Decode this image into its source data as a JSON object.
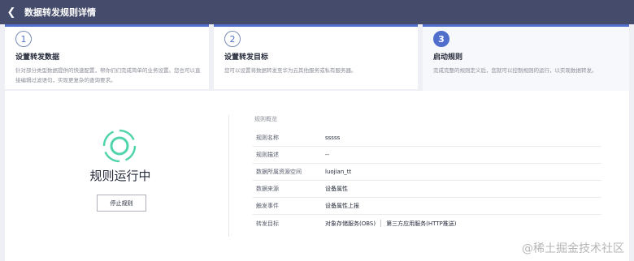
{
  "header": {
    "title": "数据转发规则详情",
    "back_icon": "chevron-left-icon"
  },
  "steps": [
    {
      "num": "1",
      "title": "设置转发数据",
      "desc": "针对部分类型数据提供的快速配置，帮你们们完成简单的业务设置。您也可以直接编辑过滤语句，实现更复杂的查询要求。"
    },
    {
      "num": "2",
      "title": "设置转发目标",
      "desc": "您可以设置将数据转发至华为云其他服务或私有服务器。"
    },
    {
      "num": "3",
      "title": "启动规则",
      "desc": "完成完整的规则定义后，您就可以控制规则的运行，以实现数据转发。"
    }
  ],
  "status": {
    "text": "规则运行中",
    "stop_label": "停止规则",
    "icon": "running-ring-icon",
    "accent": "#50d4ab"
  },
  "overview": {
    "title": "规则概览",
    "rows": [
      {
        "key": "规则名称",
        "value": "sssss"
      },
      {
        "key": "规则描述",
        "value": "--"
      },
      {
        "key": "数据所属资源空间",
        "value": "luojian_tt"
      },
      {
        "key": "数据来源",
        "value": "设备属性"
      },
      {
        "key": "触发事件",
        "value": "设备属性上报"
      },
      {
        "key": "转发目标",
        "value": "对象存储服务(OBS)",
        "value2": "第三方应用服务(HTTP推送)"
      }
    ]
  },
  "watermark": "@稀土掘金技术社区",
  "colors": {
    "header_bg": "#454c6b",
    "step_accent": "#526ecc"
  }
}
